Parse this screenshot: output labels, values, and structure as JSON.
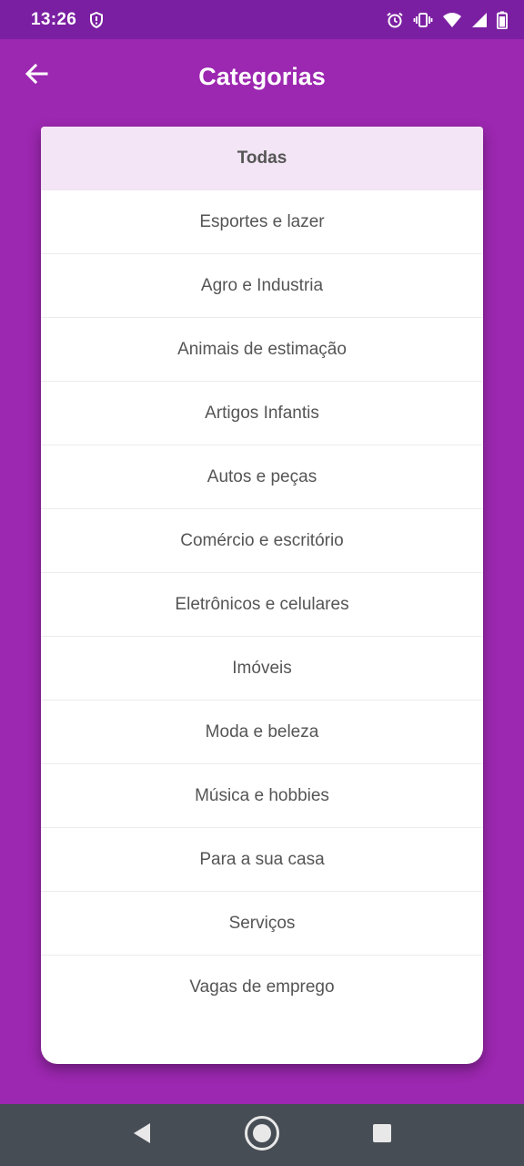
{
  "status_bar": {
    "time": "13:26",
    "icons": [
      "shield-alert-icon",
      "alarm-icon",
      "vibrate-icon",
      "wifi-icon",
      "signal-icon",
      "battery-icon"
    ]
  },
  "app_bar": {
    "title": "Categorias",
    "back_icon": "arrow-back-icon"
  },
  "categories": {
    "selected_index": 0,
    "items": [
      {
        "label": "Todas"
      },
      {
        "label": "Esportes e lazer"
      },
      {
        "label": "Agro e Industria"
      },
      {
        "label": "Animais de estimação"
      },
      {
        "label": "Artigos Infantis"
      },
      {
        "label": "Autos e peças"
      },
      {
        "label": "Comércio e escritório"
      },
      {
        "label": "Eletrônicos e celulares"
      },
      {
        "label": "Imóveis"
      },
      {
        "label": "Moda e beleza"
      },
      {
        "label": "Música e hobbies"
      },
      {
        "label": "Para a sua casa"
      },
      {
        "label": "Serviços"
      },
      {
        "label": "Vagas de emprego"
      }
    ]
  },
  "nav_bar": {
    "icons": [
      "back-triangle-icon",
      "home-circle-icon",
      "recents-square-icon"
    ]
  },
  "colors": {
    "primary": "#9c27b0",
    "status_bar": "#7b1fa2",
    "selected_bg": "#f3e5f5",
    "nav_bar": "#474d55"
  }
}
